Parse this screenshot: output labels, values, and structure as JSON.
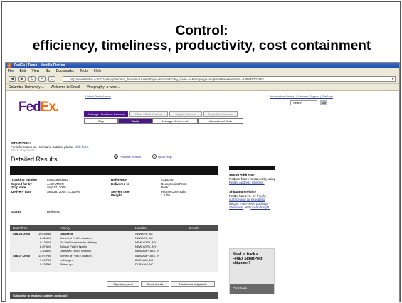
{
  "slide": {
    "title_line1": "Control:",
    "title_line2": "efficiency, timeliness, productivity, cost containment"
  },
  "browser": {
    "window_title": "FedEx | Track - Mozilla Firefox",
    "menu": [
      "File",
      "Edit",
      "View",
      "Go",
      "Bookmarks",
      "Tools",
      "Help"
    ],
    "url": "http://www.fedex.com/Tracking?ascend_header=1&clienttype=dotcom&cntry_code=us&language=english&tracknumbers=848839303952",
    "bookmarks": [
      "Columbia University ...",
      "Welcome to Gmail",
      "Vinography: a wine..."
    ]
  },
  "fedex": {
    "logo_fed": "Fed",
    "logo_ex": "Ex",
    "logo_dot": ".",
    "home_link": "United States Home",
    "top_links": "Information Center  |  Customer Support  |  Site Map",
    "search_placeholder": "Search",
    "go_label": "Go",
    "tabs": [
      "Package / Envelope Services",
      "Office / Print Services",
      "Freight Services",
      "Expedited Services"
    ],
    "subtabs": [
      "Ship",
      "Track",
      "Manage My Account",
      "International Tools"
    ],
    "important_label": "IMPORTANT!",
    "important_text": "For information on Hurricane Katrina, please ",
    "important_link": "click here.",
    "track_shipments": "Track Shipments",
    "page_heading": "Detailed Results",
    "printable": "Printable Version",
    "quick_help": "Quick Help"
  },
  "shipment": {
    "labels_left": [
      "Tracking number",
      "Signed for by",
      "Ship date",
      "Delivery date"
    ],
    "values_left": [
      "848839303952",
      "A.SHUMER",
      "Sep 27, 2005",
      "Sep 28, 2005 10:20 AM"
    ],
    "labels_right": [
      "Reference",
      "Delivered to",
      "",
      "Service type",
      "Weight"
    ],
    "values_right": [
      "4016348",
      "Receptionist/Front",
      "Desk",
      "Priority Overnight",
      "1.0 lbs."
    ],
    "status_label": "Status",
    "status_value": "Delivered"
  },
  "table": {
    "headers": [
      "Date/Time",
      "Activity",
      "Location",
      "Details"
    ],
    "rows": [
      {
        "date": "Sep 28, 2005",
        "time": "10:20 AM",
        "activity": "Delivered",
        "location": "NEWARK, NJ"
      },
      {
        "date": "",
        "time": "8:31 AM",
        "activity": "Arrived at FedEx location",
        "location": "NEWARK, NJ"
      },
      {
        "date": "",
        "time": "8:13 AM",
        "activity": "On FedEx vehicle for delivery",
        "location": "NEW YORK, NY"
      },
      {
        "date": "",
        "time": "8:07 AM",
        "activity": "At local FedEx facility",
        "location": "NEW YORK, NY"
      },
      {
        "date": "",
        "time": "3:33 AM",
        "activity": "Departed FedEx location",
        "location": "INDIANAPOLIS, IN"
      },
      {
        "date": "Sep 27, 2005",
        "time": "11:07 PM",
        "activity": "Arrived at FedEx location",
        "location": "INDIANAPOLIS, IN"
      },
      {
        "date": "",
        "time": "9:24 PM",
        "activity": "Left origin",
        "location": "DURHAM, NC"
      },
      {
        "date": "",
        "time": "5:23 PM",
        "activity": "Picked up",
        "location": "DURHAM, NC"
      }
    ]
  },
  "buttons": {
    "signature": "Signature proof",
    "email": "Email results",
    "track_more": "Track more shipments"
  },
  "subscribe": "Subscribe to tracking updates (optional)",
  "sidebar": {
    "wrong_title": "Wrong Address?",
    "wrong_text": "Reduce future mistakes by using",
    "wrong_link": "FedEx Address Checker.",
    "freight_title": "Shipping Freight?",
    "freight_text": "FedEx has",
    "freight_link1": "LTL, air freight,",
    "freight_link2": "surface and air expedited",
    "freight_link3": "freight, multi-piece package",
    "freight_link4": "deliveries,",
    "freight_and": "and",
    "freight_link5": "ocean freight.",
    "promo_line1": "Need to track a",
    "promo_line2": "FedEx SmartPost",
    "promo_line3": "shipment?",
    "promo_here": "Click here"
  }
}
